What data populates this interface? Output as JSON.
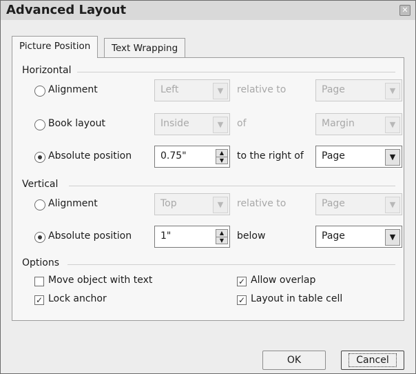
{
  "window": {
    "title": "Advanced Layout",
    "close_glyph": "✕"
  },
  "tabs": [
    {
      "label": "Picture Position",
      "active": true
    },
    {
      "label": "Text Wrapping",
      "active": false
    }
  ],
  "horizontal": {
    "group_label": "Horizontal",
    "alignment": {
      "label": "Alignment",
      "value": "Left",
      "relative_text": "relative to",
      "relative_value": "Page",
      "selected": false
    },
    "book_layout": {
      "label": "Book layout",
      "value": "Inside",
      "relative_text": "of",
      "relative_value": "Margin",
      "selected": false
    },
    "absolute": {
      "label": "Absolute position",
      "value": "0.75\"",
      "relative_text": "to the right of",
      "relative_value": "Page",
      "selected": true
    }
  },
  "vertical": {
    "group_label": "Vertical",
    "alignment": {
      "label": "Alignment",
      "value": "Top",
      "relative_text": "relative to",
      "relative_value": "Page",
      "selected": false
    },
    "absolute": {
      "label": "Absolute position",
      "value": "1\"",
      "relative_text": "below",
      "relative_value": "Page",
      "selected": true
    }
  },
  "options": {
    "group_label": "Options",
    "move_with_text": {
      "label": "Move object with text",
      "checked": false
    },
    "lock_anchor": {
      "label": "Lock anchor",
      "checked": true
    },
    "allow_overlap": {
      "label": "Allow overlap",
      "checked": true
    },
    "layout_in_cell": {
      "label": "Layout in table cell",
      "checked": true
    }
  },
  "buttons": {
    "ok": "OK",
    "cancel": "Cancel"
  },
  "icons": {
    "dropdown": "chevron-down-icon",
    "spin_up": "spin-up-icon",
    "spin_down": "spin-down-icon",
    "check": "checkmark-icon"
  },
  "colors": {
    "dialog_bg": "#ededed",
    "panel_bg": "#f7f7f7",
    "disabled_text": "#a8a8a8"
  }
}
